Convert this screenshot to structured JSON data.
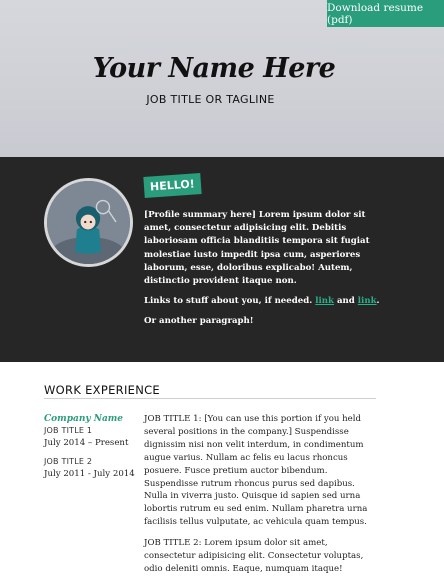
{
  "header": {
    "download_label": "Download resume (pdf)",
    "name": "Your Name Here",
    "tagline": "JOB TITLE OR TAGLINE"
  },
  "profile": {
    "hello": "HELLO!",
    "summary": "[Profile summary here] Lorem ipsum dolor sit amet, consectetur adipisicing elit. Debitis laboriosam officia blanditiis tempora sit fugiat molestiae iusto impedit ipsa cum, asperiores laborum, esse, doloribus explicabo! Autem, distinctio provident itaque non.",
    "links_prefix": "Links to stuff about you, if needed.",
    "link1": "link",
    "links_and": "and",
    "link2": "link",
    "links_suffix": ".",
    "other": "Or another paragraph!"
  },
  "work": {
    "title": "WORK EXPERIENCE",
    "company": "Company Name",
    "job1_title": "JOB TITLE 1",
    "job1_dates": "July 2014 – Present",
    "job2_title": "JOB TITLE 2",
    "job2_dates": "July 2011 - July 2014",
    "job1_desc": "JOB TITLE 1: [You can use this portion if you held several positions in the company.] Suspendisse dignissim nisi non velit interdum, in condimentum augue varius. Nullam ac felis eu lacus rhoncus posuere. Fusce pretium auctor bibendum. Suspendisse rutrum rhoncus purus sed dapibus. Nulla in viverra justo. Quisque id sapien sed urna lobortis rutrum eu sed enim. Nullam pharetra urna facilisis tellus vulputate, ac vehicula quam tempus.",
    "job2_desc": "JOB TITLE 2: Lorem ipsum dolor sit amet, consectetur adipisicing elit. Consectetur voluptas, odio deleniti omnis. Eaque, numquam itaque!"
  },
  "colors": {
    "accent": "#2a9d7c",
    "dark_band": "#262626",
    "header_bg": "#d6d7dc"
  }
}
